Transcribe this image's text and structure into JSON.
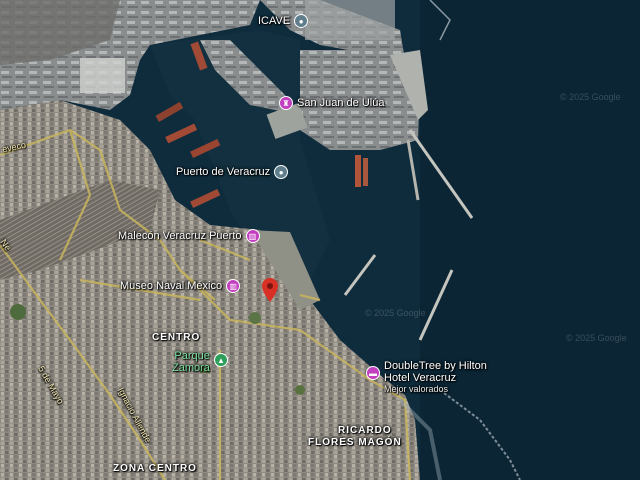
{
  "map": {
    "pois": {
      "cave": {
        "label": "ICAVE",
        "icon": "pin-circle-icon",
        "color": "#607d8b"
      },
      "san_juan": {
        "label": "San Juan de Ulúa",
        "icon": "castle-icon",
        "color": "#c23fbf"
      },
      "puerto": {
        "label": "Puerto de Veracruz",
        "icon": "pin-circle-icon",
        "color": "#607d8b"
      },
      "malecon": {
        "label": "Malecón Veracruz Puerto",
        "icon": "museum-icon",
        "color": "#c23fbf"
      },
      "museo": {
        "label": "Museo Naval México",
        "icon": "museum-icon",
        "color": "#c23fbf"
      },
      "parque": {
        "label_line1": "Parque",
        "label_line2": "Zamora",
        "icon": "tree-icon",
        "color": "#2e9e5b"
      },
      "hotel": {
        "label_line1": "DoubleTree by Hilton",
        "label_line2": "Hotel Veracruz",
        "sublabel": "Mejor valorados",
        "icon": "hotel-icon",
        "color": "#c23fbf"
      }
    },
    "areas": {
      "centro": "CENTRO",
      "ricardo_line1": "RICARDO",
      "ricardo_line2": "FLORES MAGÓN",
      "zona_centro": "ZONA CENTRO"
    },
    "roads": {
      "veveco": "eveco",
      "ne": "Ne",
      "ignacio": "Ignacio Allende",
      "cinco_mayo": "5 de Mayo"
    },
    "copyright": "© 2025 Google",
    "selected_pin_color": "#d93025"
  }
}
